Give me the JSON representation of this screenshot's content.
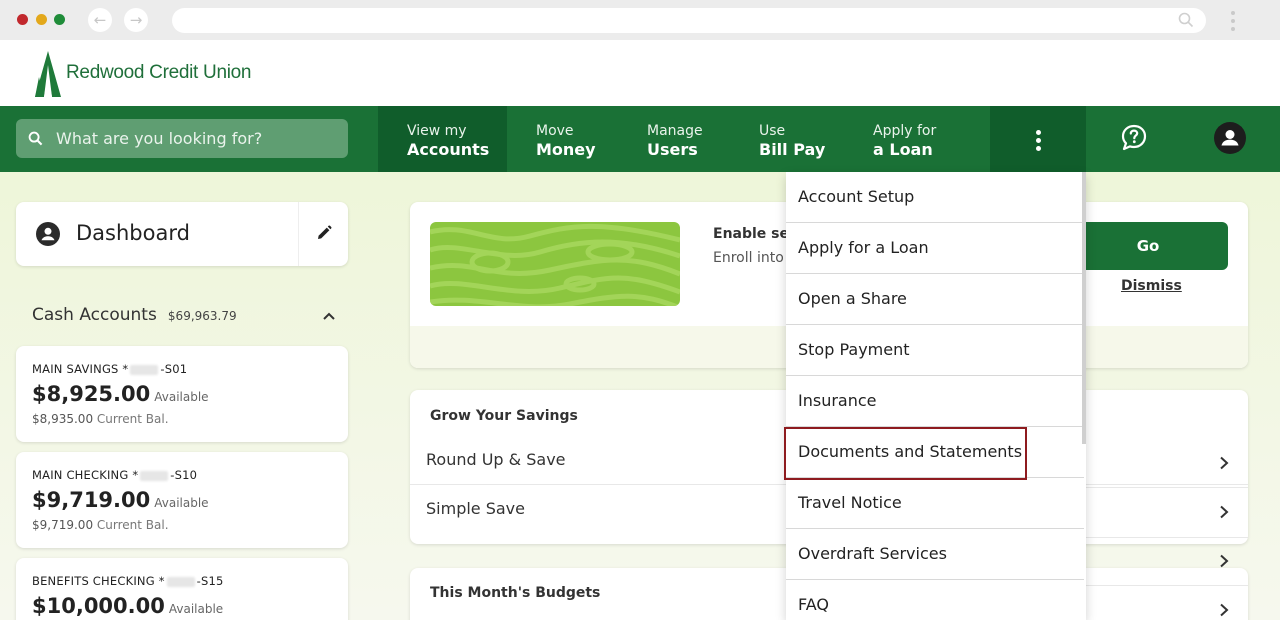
{
  "browser": {
    "back_icon": "arrow-left-icon",
    "forward_icon": "arrow-right-icon"
  },
  "brand": {
    "name": "Redwood Credit Union",
    "color": "#1a7136"
  },
  "nav": {
    "search_placeholder": "What are you looking for?",
    "items": [
      {
        "line1": "View my",
        "line2": "Accounts"
      },
      {
        "line1": "Move",
        "line2": "Money"
      },
      {
        "line1": "Manage",
        "line2": "Users"
      },
      {
        "line1": "Use",
        "line2": "Bill Pay"
      },
      {
        "line1": "Apply for",
        "line2": "a Loan"
      }
    ]
  },
  "dashboard": {
    "title": "Dashboard"
  },
  "cash_accounts": {
    "title": "Cash Accounts",
    "total": "$69,963.79",
    "accounts": [
      {
        "name": "MAIN SAVINGS",
        "prefix": "*",
        "suffix": "-S01",
        "available": "$8,925.00",
        "available_label": "Available",
        "current": "$8,935.00",
        "current_label": "Current Bal."
      },
      {
        "name": "MAIN CHECKING",
        "prefix": "*",
        "suffix": "-S10",
        "available": "$9,719.00",
        "available_label": "Available",
        "current": "$9,719.00",
        "current_label": "Current Bal."
      },
      {
        "name": "BENEFITS CHECKING",
        "prefix": "*",
        "suffix": "-S15",
        "available": "$10,000.00",
        "available_label": "Available"
      }
    ]
  },
  "promo": {
    "title": "Enable sec",
    "subtitle": "Enroll into",
    "go_label": "Go",
    "dismiss_label": "Dismiss"
  },
  "grow": {
    "title": "Grow Your Savings",
    "rows": [
      "Round Up & Save",
      "Simple Save"
    ]
  },
  "budgets": {
    "title": "This Month's Budgets"
  },
  "dropdown": {
    "items": [
      "Account Setup",
      "Apply for a Loan",
      "Open a Share",
      "Stop Payment",
      "Insurance",
      "Documents and Statements",
      "Travel Notice",
      "Overdraft Services",
      "FAQ"
    ],
    "highlighted": "Documents and Statements",
    "highlight_color": "#8e1b1f"
  }
}
